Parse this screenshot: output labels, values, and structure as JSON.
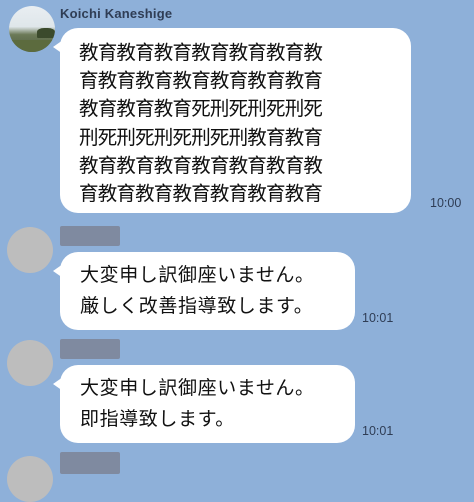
{
  "chat": {
    "messages": [
      {
        "sender": "Koichi Kaneshige",
        "lines": [
          "教育教育教育教育教育教育教",
          "育教育教育教育教育教育教育",
          "教育教育教育死刑死刑死刑死",
          "刑死刑死刑死刑死刑教育教育",
          "教育教育教育教育教育教育教",
          "育教育教育教育教育教育教育"
        ],
        "time": "10:00"
      },
      {
        "lines": [
          "大変申し訳御座いません。",
          "厳しく改善指導致します。"
        ],
        "time": "10:01"
      },
      {
        "lines": [
          "大変申し訳御座いません。",
          "即指導致します。"
        ],
        "time": "10:01"
      }
    ]
  },
  "colors": {
    "background": "#8eb0d9",
    "bubble": "#ffffff",
    "meta_text": "#2f3d55",
    "avatar_placeholder": "#bdbdbd",
    "name_redaction": "#7f8aa0"
  }
}
